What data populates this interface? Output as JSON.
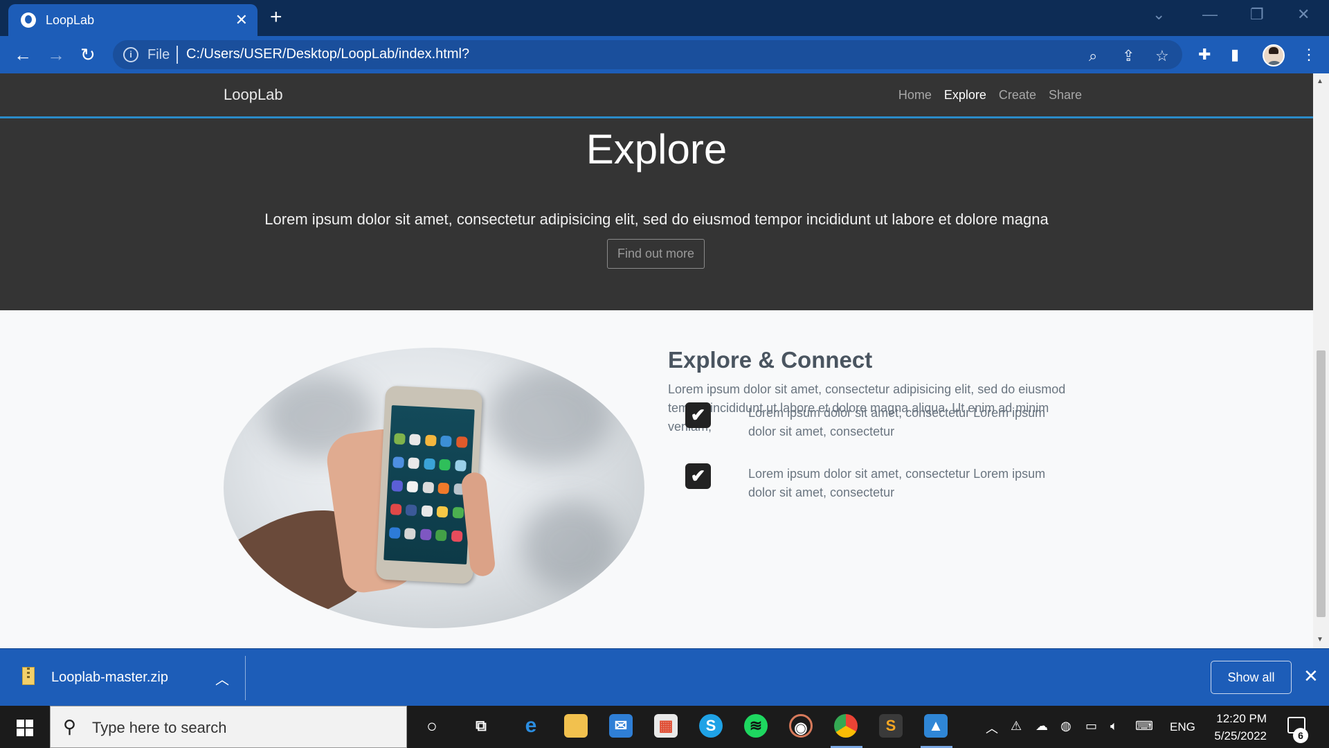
{
  "browser": {
    "tab_title": "LoopLab",
    "address": {
      "scheme_label": "File",
      "url": "C:/Users/USER/Desktop/LoopLab/index.html?"
    }
  },
  "site": {
    "brand": "LoopLab",
    "nav": [
      {
        "label": "Home",
        "active": false
      },
      {
        "label": "Explore",
        "active": true
      },
      {
        "label": "Create",
        "active": false
      },
      {
        "label": "Share",
        "active": false
      }
    ],
    "hero": {
      "title": "Explore",
      "subtitle": "Lorem ipsum dolor sit amet, consectetur adipisicing elit, sed do eiusmod tempor incididunt ut labore et dolore magna",
      "button": "Find out more"
    },
    "feature": {
      "title": "Explore & Connect",
      "text": "Lorem ipsum dolor sit amet, consectetur adipisicing elit, sed do eiusmod tempor incididunt ut labore et dolore magna aliqua. Ut enim ad minim veniam,",
      "checks": [
        "Lorem ipsum dolor sit amet, consectetur Lorem ipsum dolor sit amet, consectetur",
        "Lorem ipsum dolor sit amet, consectetur Lorem ipsum dolor sit amet, consectetur"
      ]
    }
  },
  "downloads": {
    "file_name": "Looplab-master.zip",
    "show_all": "Show all"
  },
  "taskbar": {
    "search_placeholder": "Type here to search",
    "language": "ENG",
    "time": "12:20 PM",
    "date": "5/25/2022",
    "notification_count": "6"
  },
  "colors": {
    "chrome_dark": "#0d2c55",
    "chrome_blue": "#1d5db8",
    "site_dark": "#343434",
    "site_accent": "#2b8bc8"
  }
}
